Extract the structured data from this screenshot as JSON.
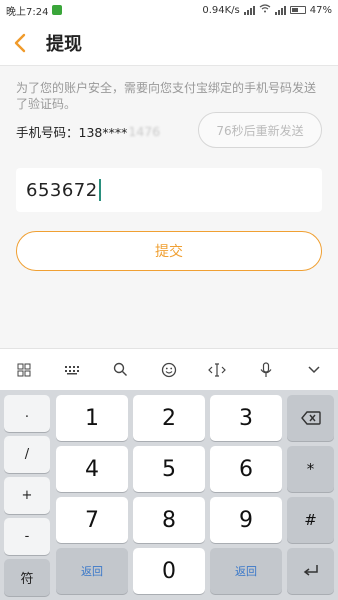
{
  "status_bar": {
    "time": "晚上7:24",
    "network_speed": "0.94K/s",
    "battery": "47%"
  },
  "header": {
    "title": "提现"
  },
  "content": {
    "notice": "为了您的账户安全，需要向您支付宝绑定的手机号码发送了验证码。",
    "phone_label": "手机号码：138****",
    "phone_hidden_tail": "1476",
    "resend_label": "76秒后重新发送",
    "code_value": "653672",
    "submit_label": "提交"
  },
  "keyboard": {
    "toolbar_icons": [
      "grid-icon",
      "keypad-icon",
      "search-icon",
      "emoji-icon",
      "cursor-icon",
      "microphone-icon",
      "collapse-icon"
    ],
    "left_column": [
      ".",
      "/",
      "+",
      "-",
      "符"
    ],
    "digits": {
      "k1": "1",
      "k2": "2",
      "k3": "3",
      "k4": "4",
      "k5": "5",
      "k6": "6",
      "k7": "7",
      "k8": "8",
      "k9": "9",
      "k0": "0"
    },
    "back_left": "返回",
    "back_right": "返回",
    "right_star": "*",
    "right_hash": "#"
  }
}
